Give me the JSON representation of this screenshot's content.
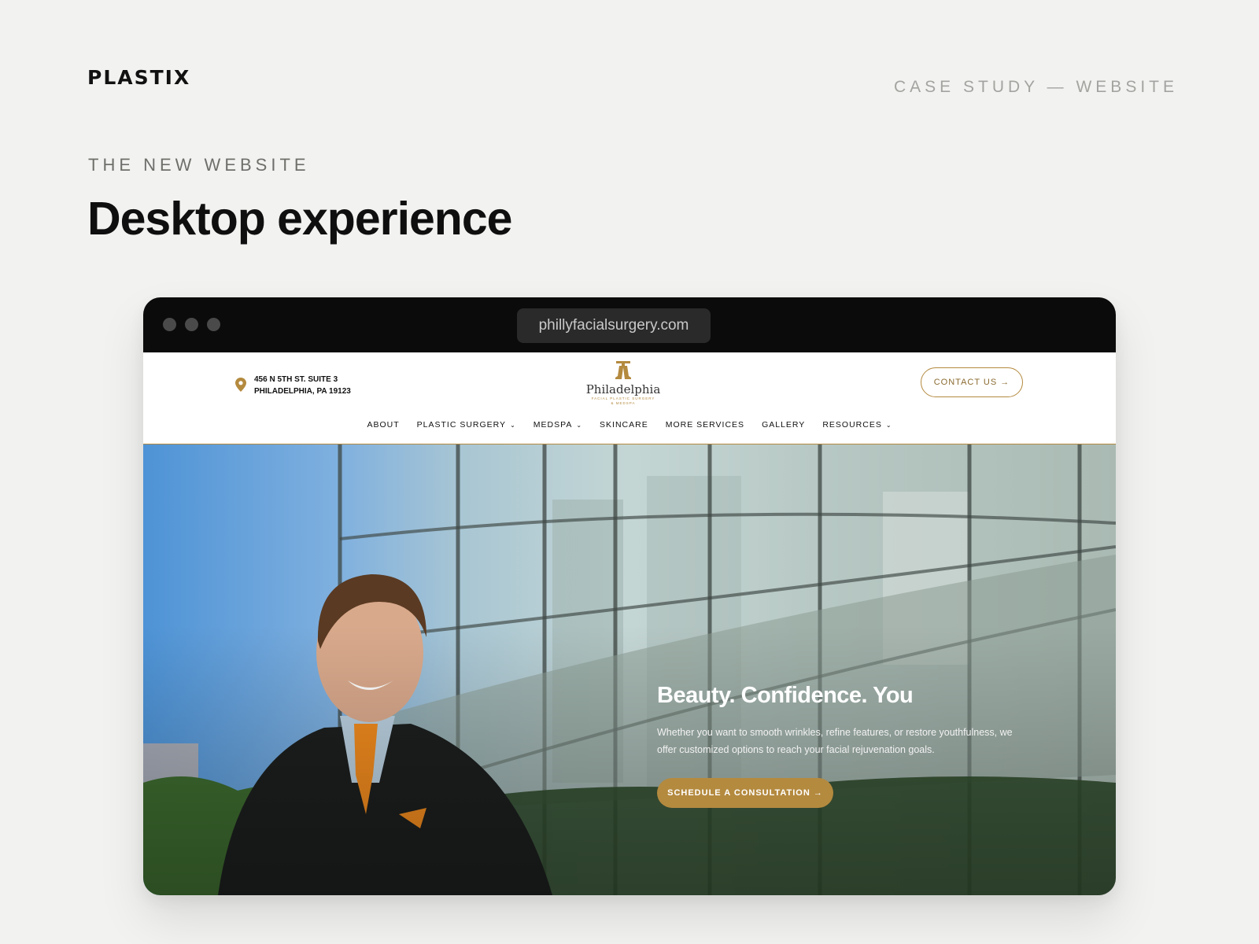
{
  "header": {
    "logo_text": "PLASTIX",
    "case_label": "CASE STUDY — WEBSITE"
  },
  "section": {
    "eyebrow": "THE NEW WEBSITE",
    "title": "Desktop experience"
  },
  "browser": {
    "url": "phillyfacialsurgery.com"
  },
  "site": {
    "address_line1": "456 N 5TH ST. SUITE 3",
    "address_line2": "PHILADELPHIA, PA 19123",
    "logo_name": "Philadelphia",
    "logo_sub1": "FACIAL PLASTIC SURGERY",
    "logo_sub2": "& MEDSPA",
    "contact_label": "CONTACT US →",
    "nav": [
      {
        "label": "ABOUT",
        "dropdown": false
      },
      {
        "label": "PLASTIC SURGERY",
        "dropdown": true
      },
      {
        "label": "MEDSPA",
        "dropdown": true
      },
      {
        "label": "SKINCARE",
        "dropdown": false
      },
      {
        "label": "MORE SERVICES",
        "dropdown": false
      },
      {
        "label": "GALLERY",
        "dropdown": false
      },
      {
        "label": "RESOURCES",
        "dropdown": true
      }
    ],
    "chevron": "⌄"
  },
  "hero": {
    "title": "Beauty. Confidence. You",
    "text": "Whether you want to smooth wrinkles, refine features, or restore youthfulness, we offer customized options to reach your facial rejuvenation goals.",
    "cta_label": "SCHEDULE A CONSULTATION →"
  },
  "colors": {
    "accent": "#b48a3f",
    "page_bg": "#f2f2f0",
    "browser_bar": "#0b0b0b"
  },
  "icons": [
    "location-pin-icon",
    "liberty-bell-icon",
    "chevron-down-icon",
    "arrow-right-icon"
  ]
}
